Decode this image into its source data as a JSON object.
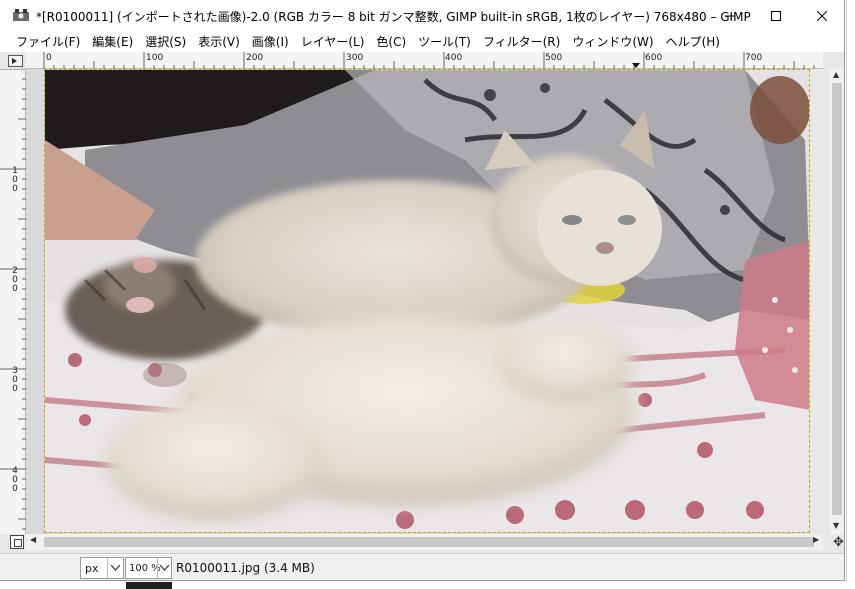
{
  "window": {
    "title": "*[R0100011] (インポートされた画像)-2.0 (RGB カラー 8 bit ガンマ整数, GIMP built-in sRGB, 1枚のレイヤー) 768x480 – GIMP",
    "controls": [
      "minimize",
      "maximize",
      "close"
    ]
  },
  "menu": {
    "items": [
      {
        "label": "ファイル(F)"
      },
      {
        "label": "編集(E)"
      },
      {
        "label": "選択(S)"
      },
      {
        "label": "表示(V)"
      },
      {
        "label": "画像(I)"
      },
      {
        "label": "レイヤー(L)"
      },
      {
        "label": "色(C)"
      },
      {
        "label": "ツール(T)"
      },
      {
        "label": "フィルター(R)"
      },
      {
        "label": "ウィンドウ(W)"
      },
      {
        "label": "ヘルプ(H)"
      }
    ]
  },
  "rulers": {
    "horizontal": [
      "0",
      "100",
      "200",
      "300",
      "400",
      "500",
      "600",
      "700"
    ],
    "vertical": [
      "1 0 0",
      "2 0 0",
      "3 0 0",
      "4 0 0"
    ]
  },
  "statusbar": {
    "unit": "px",
    "zoom": "100 %",
    "file_info": "R0100011.jpg (3.4 MB)"
  },
  "icons": {
    "app": "gimp-icon",
    "navigate": "navigate-icon",
    "zoom_fit": "zoom-fit-icon",
    "dropdown": "chevron-down-icon"
  },
  "colors": {
    "titlebar_bg": "#ffffff",
    "window_bg": "#f0f0f0",
    "selection_border": "#c8a800"
  }
}
